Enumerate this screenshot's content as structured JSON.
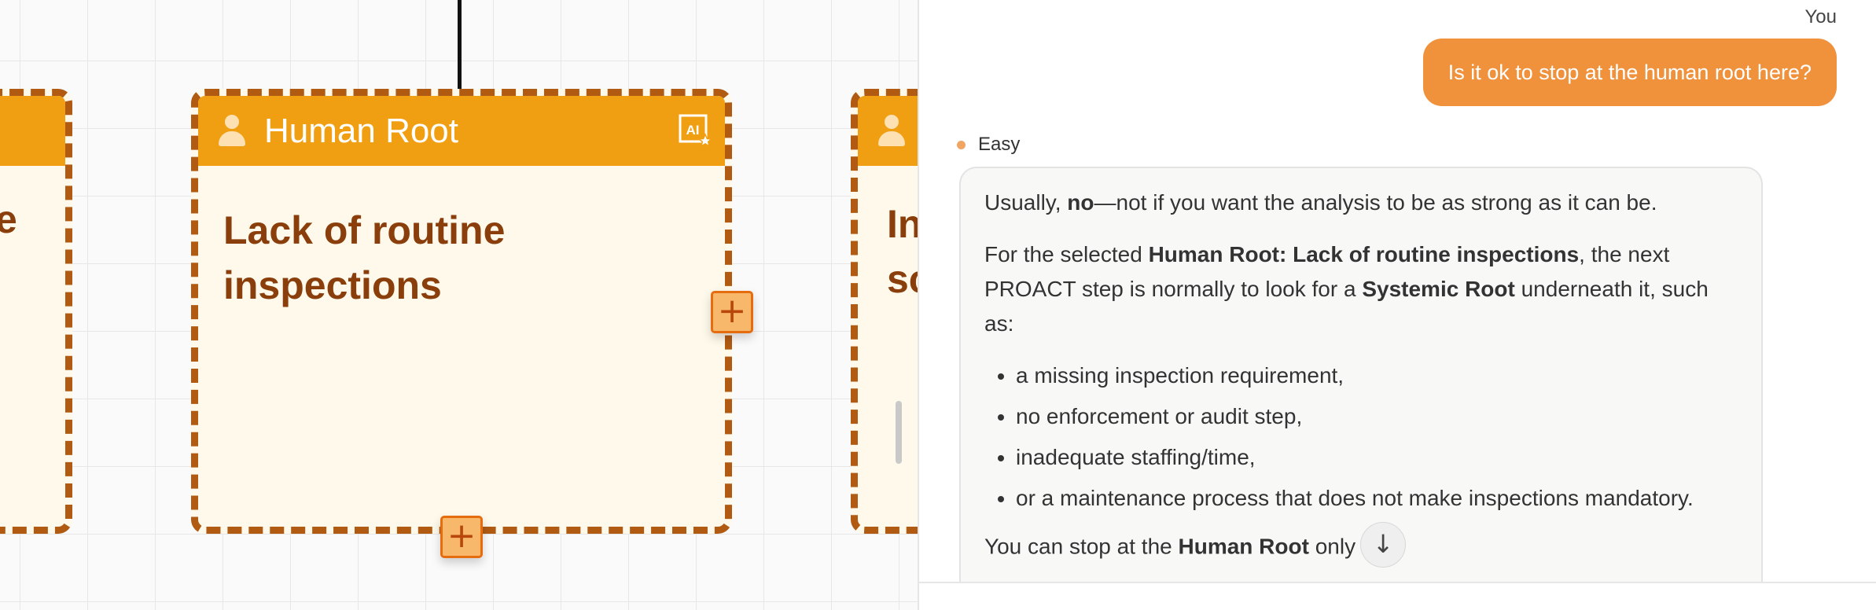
{
  "canvas": {
    "left_card": {
      "body_fragment": "e"
    },
    "main_card": {
      "header_title": "Human Root",
      "body_text": "Lack of routine inspections",
      "ai_badge": "AI",
      "add_right_label": "+",
      "add_bottom_label": "+"
    },
    "right_card": {
      "body_fragment_line1": "In",
      "body_fragment_line2": "sc"
    }
  },
  "chat": {
    "user_label": "You",
    "user_message": "Is it ok to stop at the human root here?",
    "assistant_mode": "Easy",
    "reply": {
      "p1_pre": "Usually, ",
      "p1_bold": "no",
      "p1_post": "—not if you want the analysis to be as strong as it can be.",
      "p2_pre": "For the selected ",
      "p2_bold1": "Human Root: Lack of routine inspections",
      "p2_mid": ", the next PROACT step is normally to look for a ",
      "p2_bold2": "Systemic Root",
      "p2_post": " underneath it, such as:",
      "bullets": [
        "a missing inspection requirement,",
        "no enforcement or audit step,",
        "inadequate staffing/time,",
        "or a maintenance process that does not make inspections mandatory."
      ],
      "p3_pre": "You can stop at the ",
      "p3_bold": "Human Root",
      "p3_post": " only"
    },
    "scroll_down_icon": "arrow-down-icon"
  },
  "colors": {
    "card_header": "#f19f12",
    "card_border": "#b05a12",
    "card_body": "#fef9ea",
    "user_bubble": "#f0913c"
  }
}
